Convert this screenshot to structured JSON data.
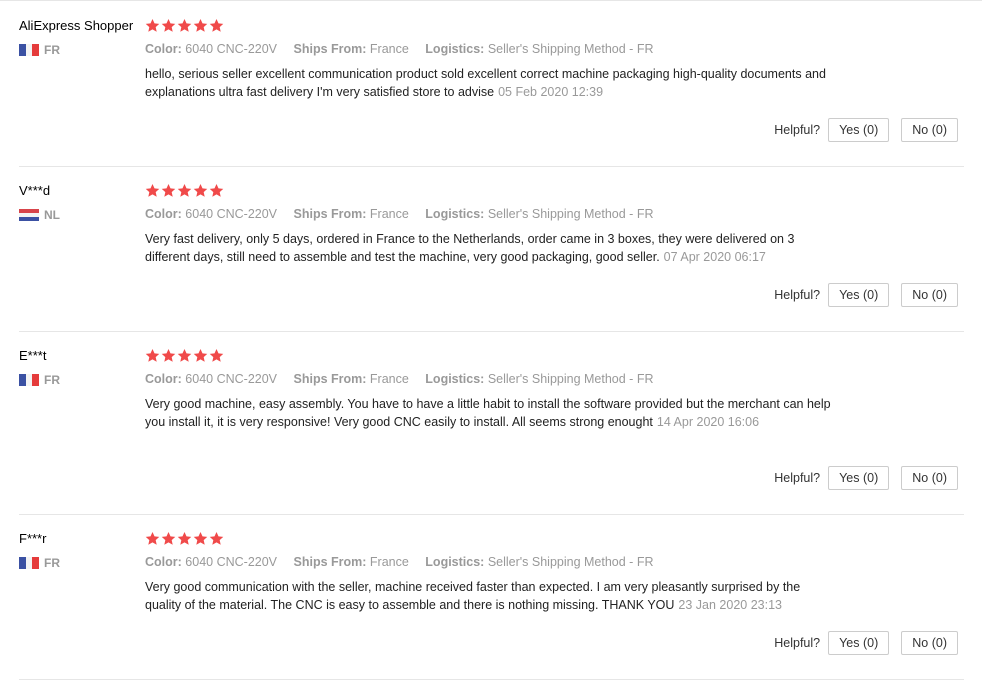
{
  "labels": {
    "color": "Color:",
    "ships_from": "Ships From:",
    "logistics": "Logistics:",
    "helpful": "Helpful?"
  },
  "reviews": [
    {
      "user": "AliExpress Shopper",
      "country": "FR",
      "rating": 5,
      "color": "6040 CNC-220V",
      "ships_from": "France",
      "logistics": "Seller's Shipping Method - FR",
      "text": "hello, serious seller excellent communication product sold excellent correct machine packaging high-quality documents and explanations ultra fast delivery I'm very satisfied store to advise",
      "date": "05 Feb 2020 12:39",
      "yes": "Yes (0)",
      "no": "No (0)"
    },
    {
      "user": "V***d",
      "country": "NL",
      "rating": 5,
      "color": "6040 CNC-220V",
      "ships_from": "France",
      "logistics": "Seller's Shipping Method - FR",
      "text": "Very fast delivery, only 5 days, ordered in France to the Netherlands, order came in 3 boxes, they were delivered on 3 different days, still need to assemble and test the machine, very good packaging, good seller.",
      "date": "07 Apr 2020 06:17",
      "yes": "Yes (0)",
      "no": "No (0)"
    },
    {
      "user": "E***t",
      "country": "FR",
      "rating": 5,
      "color": "6040 CNC-220V",
      "ships_from": "France",
      "logistics": "Seller's Shipping Method - FR",
      "text": "Very good machine, easy assembly. You have to have a little habit to install the software provided but the merchant can help you install it, it is very responsive! Very good CNC easily to install. All seems strong enought",
      "date": "14 Apr 2020 16:06",
      "yes": "Yes (0)",
      "no": "No (0)"
    },
    {
      "user": "F***r",
      "country": "FR",
      "rating": 5,
      "color": "6040 CNC-220V",
      "ships_from": "France",
      "logistics": "Seller's Shipping Method - FR",
      "text": "Very good communication with the seller, machine received faster than expected. I am very pleasantly surprised by the quality of the material. The CNC is easy to assemble and there is nothing missing. THANK YOU",
      "date": "23 Jan 2020 23:13",
      "yes": "Yes (0)",
      "no": "No (0)"
    }
  ],
  "colors": {
    "star": "#f04a4a",
    "border": "#e6e6e6"
  }
}
